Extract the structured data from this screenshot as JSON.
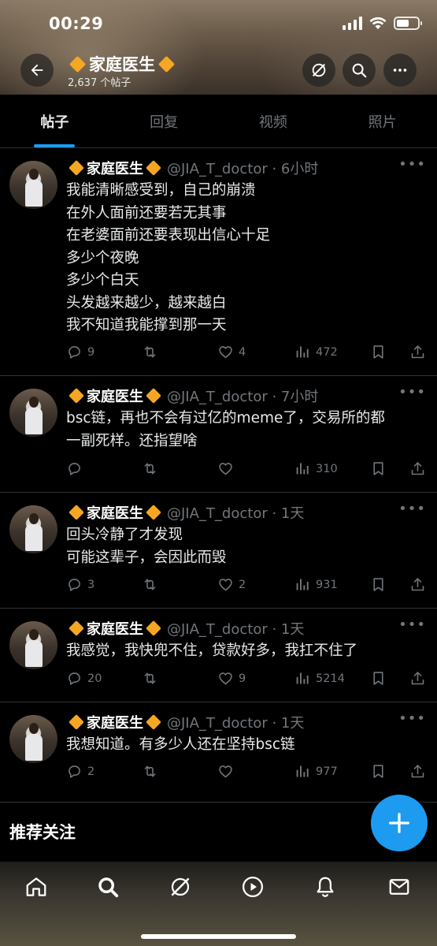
{
  "status_bar": {
    "time": "00:29"
  },
  "profile": {
    "name": "家庭医生",
    "post_count": "2,637 个帖子"
  },
  "tabs": [
    {
      "label": "帖子",
      "active": true
    },
    {
      "label": "回复",
      "active": false
    },
    {
      "label": "视频",
      "active": false
    },
    {
      "label": "照片",
      "active": false
    }
  ],
  "posts": [
    {
      "name": "家庭医生",
      "handle": "@JIA_T_doctor · 6小时",
      "lines": [
        "我能清晰感受到，自己的崩溃",
        "在外人面前还要若无其事",
        "在老婆面前还要表现出信心十足",
        "多少个夜晚",
        "多少个白天",
        "头发越来越少，越来越白",
        "我不知道我能撑到那一天"
      ],
      "replies": "9",
      "reposts": "",
      "likes": "4",
      "views": "472"
    },
    {
      "name": "家庭医生",
      "handle": "@JIA_T_doctor · 7小时",
      "lines": [
        "bsc链，再也不会有过亿的meme了，交易所的都",
        "一副死样。还指望啥"
      ],
      "replies": "",
      "reposts": "",
      "likes": "",
      "views": "310"
    },
    {
      "name": "家庭医生",
      "handle": "@JIA_T_doctor · 1天",
      "lines": [
        "回头冷静了才发现",
        "可能这辈子，会因此而毁"
      ],
      "replies": "3",
      "reposts": "",
      "likes": "2",
      "views": "931"
    },
    {
      "name": "家庭医生",
      "handle": "@JIA_T_doctor · 1天",
      "lines": [
        "我感觉，我快兜不住，贷款好多，我扛不住了"
      ],
      "replies": "20",
      "reposts": "",
      "likes": "9",
      "views": "5214"
    },
    {
      "name": "家庭医生",
      "handle": "@JIA_T_doctor · 1天",
      "lines": [
        "我想知道。有多少人还在坚持bsc链"
      ],
      "replies": "2",
      "reposts": "",
      "likes": "",
      "views": "977"
    }
  ],
  "recommended": {
    "title": "推荐关注"
  },
  "colors": {
    "accent": "#1d9bf0",
    "diamond": "#f5a623",
    "muted": "#71767b"
  },
  "icons": [
    "back-arrow-icon",
    "grok-icon",
    "search-icon",
    "more-icon",
    "reply-icon",
    "repost-icon",
    "like-icon",
    "views-icon",
    "bookmark-icon",
    "share-icon",
    "compose-icon",
    "home-icon",
    "explore-icon",
    "play-icon",
    "bell-icon",
    "mail-icon"
  ]
}
